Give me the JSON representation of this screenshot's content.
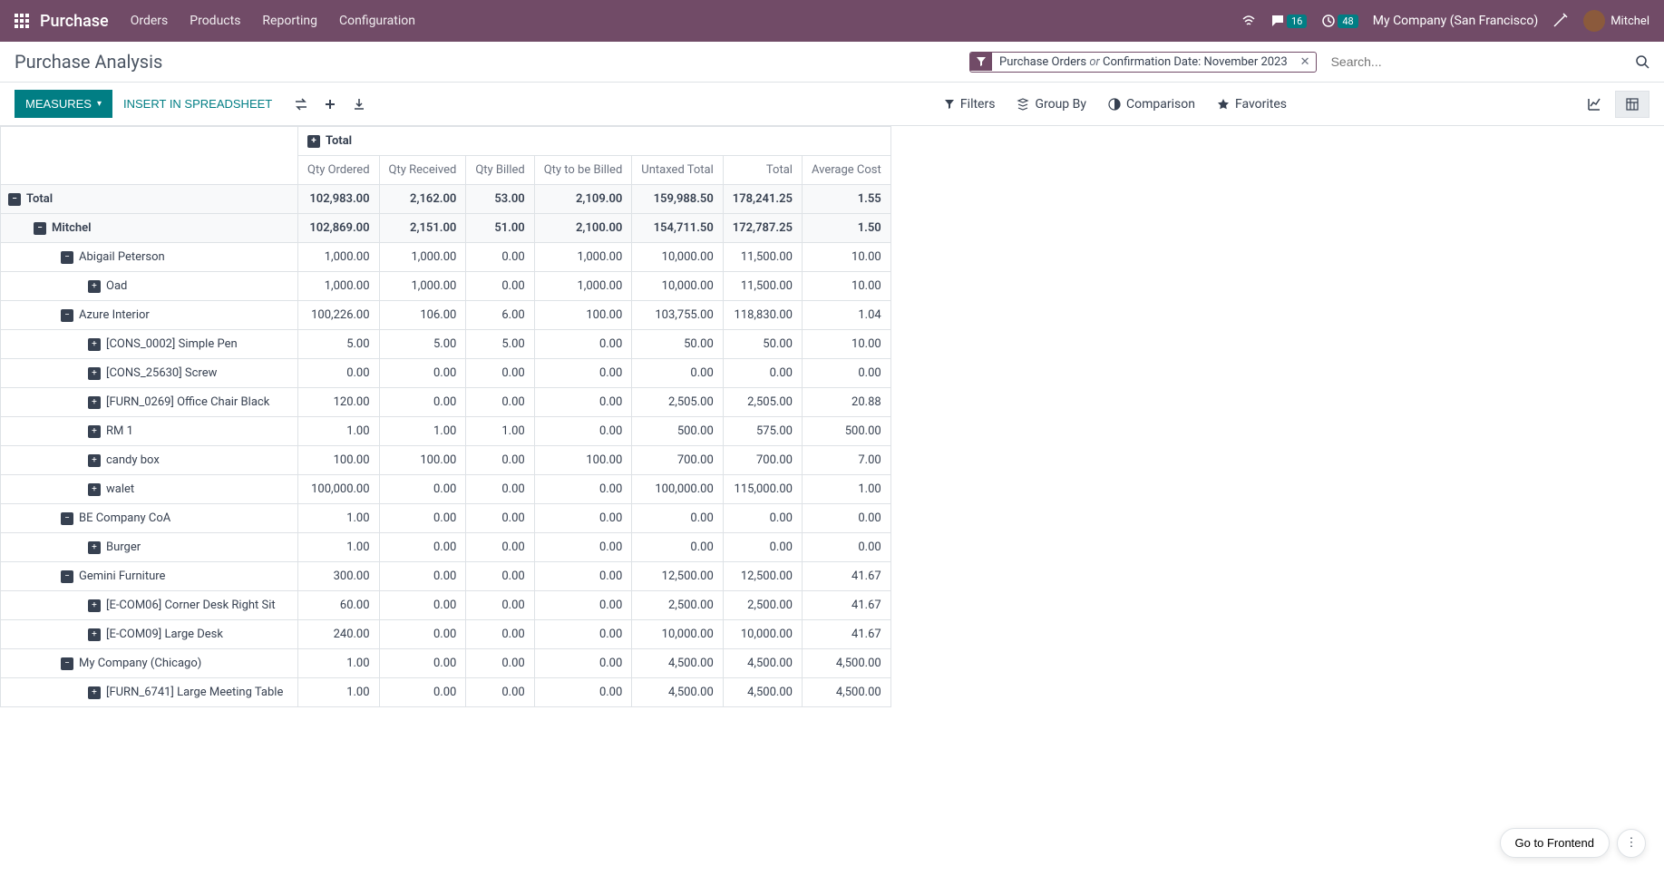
{
  "header": {
    "app_name": "Purchase",
    "nav_items": [
      "Orders",
      "Products",
      "Reporting",
      "Configuration"
    ],
    "discuss_badge": "16",
    "activity_badge": "48",
    "company": "My Company (San Francisco)",
    "user": "Mitchel"
  },
  "page": {
    "title": "Purchase Analysis",
    "search_facet_prefix": "Purchase Orders",
    "search_facet_sep": "or",
    "search_facet_suffix": "Confirmation Date: November 2023",
    "search_placeholder": "Search..."
  },
  "controls": {
    "measures": "MEASURES",
    "spreadsheet": "INSERT IN SPREADSHEET",
    "filters": "Filters",
    "group_by": "Group By",
    "comparison": "Comparison",
    "favorites": "Favorites"
  },
  "pivot": {
    "total_label": "Total",
    "columns": [
      "Qty Ordered",
      "Qty Received",
      "Qty Billed",
      "Qty to be Billed",
      "Untaxed Total",
      "Total",
      "Average Cost"
    ],
    "rows": [
      {
        "label": "Total",
        "indent": 0,
        "icon": "minus",
        "bold": true,
        "vals": [
          "102,983.00",
          "2,162.00",
          "53.00",
          "2,109.00",
          "159,988.50",
          "178,241.25",
          "1.55"
        ]
      },
      {
        "label": "Mitchel",
        "indent": 1,
        "icon": "minus",
        "bold": true,
        "vals": [
          "102,869.00",
          "2,151.00",
          "51.00",
          "2,100.00",
          "154,711.50",
          "172,787.25",
          "1.50"
        ]
      },
      {
        "label": "Abigail Peterson",
        "indent": 2,
        "icon": "minus",
        "bold": false,
        "vals": [
          "1,000.00",
          "1,000.00",
          "0.00",
          "1,000.00",
          "10,000.00",
          "11,500.00",
          "10.00"
        ]
      },
      {
        "label": "Oad",
        "indent": 3,
        "icon": "plus",
        "bold": false,
        "vals": [
          "1,000.00",
          "1,000.00",
          "0.00",
          "1,000.00",
          "10,000.00",
          "11,500.00",
          "10.00"
        ]
      },
      {
        "label": "Azure Interior",
        "indent": 2,
        "icon": "minus",
        "bold": false,
        "vals": [
          "100,226.00",
          "106.00",
          "6.00",
          "100.00",
          "103,755.00",
          "118,830.00",
          "1.04"
        ]
      },
      {
        "label": "[CONS_0002] Simple Pen",
        "indent": 3,
        "icon": "plus",
        "bold": false,
        "vals": [
          "5.00",
          "5.00",
          "5.00",
          "0.00",
          "50.00",
          "50.00",
          "10.00"
        ]
      },
      {
        "label": "[CONS_25630] Screw",
        "indent": 3,
        "icon": "plus",
        "bold": false,
        "vals": [
          "0.00",
          "0.00",
          "0.00",
          "0.00",
          "0.00",
          "0.00",
          "0.00"
        ]
      },
      {
        "label": "[FURN_0269] Office Chair Black",
        "indent": 3,
        "icon": "plus",
        "bold": false,
        "vals": [
          "120.00",
          "0.00",
          "0.00",
          "0.00",
          "2,505.00",
          "2,505.00",
          "20.88"
        ]
      },
      {
        "label": "RM 1",
        "indent": 3,
        "icon": "plus",
        "bold": false,
        "vals": [
          "1.00",
          "1.00",
          "1.00",
          "0.00",
          "500.00",
          "575.00",
          "500.00"
        ]
      },
      {
        "label": "candy box",
        "indent": 3,
        "icon": "plus",
        "bold": false,
        "vals": [
          "100.00",
          "100.00",
          "0.00",
          "100.00",
          "700.00",
          "700.00",
          "7.00"
        ]
      },
      {
        "label": "walet",
        "indent": 3,
        "icon": "plus",
        "bold": false,
        "vals": [
          "100,000.00",
          "0.00",
          "0.00",
          "0.00",
          "100,000.00",
          "115,000.00",
          "1.00"
        ]
      },
      {
        "label": "BE Company CoA",
        "indent": 2,
        "icon": "minus",
        "bold": false,
        "vals": [
          "1.00",
          "0.00",
          "0.00",
          "0.00",
          "0.00",
          "0.00",
          "0.00"
        ]
      },
      {
        "label": "Burger",
        "indent": 3,
        "icon": "plus",
        "bold": false,
        "vals": [
          "1.00",
          "0.00",
          "0.00",
          "0.00",
          "0.00",
          "0.00",
          "0.00"
        ]
      },
      {
        "label": "Gemini Furniture",
        "indent": 2,
        "icon": "minus",
        "bold": false,
        "vals": [
          "300.00",
          "0.00",
          "0.00",
          "0.00",
          "12,500.00",
          "12,500.00",
          "41.67"
        ]
      },
      {
        "label": "[E-COM06] Corner Desk Right Sit",
        "indent": 3,
        "icon": "plus",
        "bold": false,
        "vals": [
          "60.00",
          "0.00",
          "0.00",
          "0.00",
          "2,500.00",
          "2,500.00",
          "41.67"
        ]
      },
      {
        "label": "[E-COM09] Large Desk",
        "indent": 3,
        "icon": "plus",
        "bold": false,
        "vals": [
          "240.00",
          "0.00",
          "0.00",
          "0.00",
          "10,000.00",
          "10,000.00",
          "41.67"
        ]
      },
      {
        "label": "My Company (Chicago)",
        "indent": 2,
        "icon": "minus",
        "bold": false,
        "vals": [
          "1.00",
          "0.00",
          "0.00",
          "0.00",
          "4,500.00",
          "4,500.00",
          "4,500.00"
        ]
      },
      {
        "label": "[FURN_6741] Large Meeting Table",
        "indent": 3,
        "icon": "plus",
        "bold": false,
        "vals": [
          "1.00",
          "0.00",
          "0.00",
          "0.00",
          "4,500.00",
          "4,500.00",
          "4,500.00"
        ]
      }
    ]
  },
  "frontend_btn": "Go to Frontend"
}
